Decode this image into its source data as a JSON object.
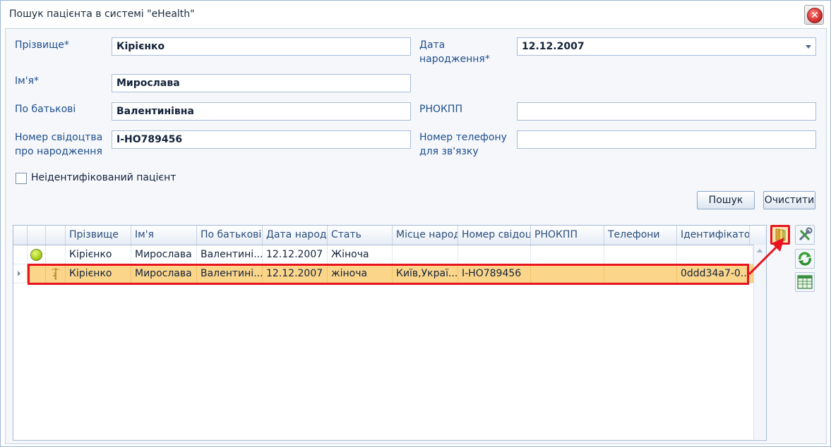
{
  "window": {
    "title": "Пошук пацієнта в системі \"eHealth\""
  },
  "form": {
    "surname_label": "Прізвище*",
    "surname_value": "Кірієнко",
    "birthdate_label_1": "Дата",
    "birthdate_label_2": "народження*",
    "birthdate_value": "12.12.2007",
    "name_label": "Ім'я*",
    "name_value": "Мирослава",
    "patronymic_label": "По батькові",
    "patronymic_value": "Валентинівна",
    "rnokpp_label": "РНОКПП",
    "rnokpp_value": "",
    "cert_label_1": "Номер свідоцтва",
    "cert_label_2": "про народження",
    "cert_value": "І-НО789456",
    "phone_label_1": "Номер телефону",
    "phone_label_2": "для зв'язку",
    "phone_value": "",
    "unidentified_label": "Неідентифікований пацієнт",
    "search_button": "Пошук",
    "clear_button": "Очистити"
  },
  "grid": {
    "columns": [
      "Прізвище",
      "Ім'я",
      "По батькові",
      "Дата народж",
      "Стать",
      "Місце народ",
      "Номер свідоц",
      "РНОКПП",
      "Телефони",
      "Ідентифікатор"
    ],
    "rows": [
      {
        "status_icon": "green-circle-icon",
        "surname": "Кірієнко",
        "name": "Мирослава",
        "patronymic": "Валентині...",
        "birthdate": "12.12.2007",
        "sex": "Жіноча",
        "birthplace": "",
        "cert": "",
        "rnokpp": "",
        "phones": "",
        "id": ""
      },
      {
        "status_icon": "caduceus-icon",
        "surname": "Кірієнко",
        "name": "Мирослава",
        "patronymic": "Валентині...",
        "birthdate": "12.12.2007",
        "sex": "жіноча",
        "birthplace": "Київ,Украї...",
        "cert": "І-НО789456",
        "rnokpp": "",
        "phones": "",
        "id": "0ddd34a7-0..."
      }
    ]
  },
  "colors": {
    "highlight": "#e8131f",
    "selected_row": "#fbd58a"
  }
}
